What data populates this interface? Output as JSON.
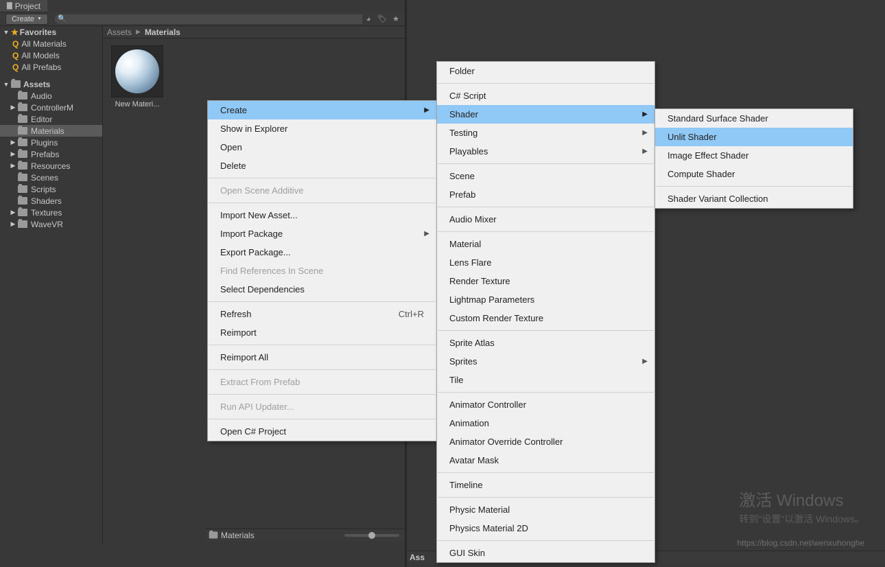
{
  "tab": {
    "title": "Project"
  },
  "toolbar": {
    "create": "Create",
    "search_placeholder": ""
  },
  "sidebar": {
    "favorites": {
      "label": "Favorites",
      "items": [
        "All Materials",
        "All Models",
        "All Prefabs"
      ]
    },
    "assets": {
      "label": "Assets",
      "items": [
        {
          "name": "Audio",
          "expand": false
        },
        {
          "name": "ControllerM",
          "expand": true
        },
        {
          "name": "Editor",
          "expand": false
        },
        {
          "name": "Materials",
          "expand": false,
          "selected": true
        },
        {
          "name": "Plugins",
          "expand": true
        },
        {
          "name": "Prefabs",
          "expand": true
        },
        {
          "name": "Resources",
          "expand": true
        },
        {
          "name": "Scenes",
          "expand": false
        },
        {
          "name": "Scripts",
          "expand": false
        },
        {
          "name": "Shaders",
          "expand": false
        },
        {
          "name": "Textures",
          "expand": true
        },
        {
          "name": "WaveVR",
          "expand": true
        }
      ]
    }
  },
  "breadcrumb": {
    "root": "Assets",
    "current": "Materials"
  },
  "assets": [
    {
      "name": "New Materi..."
    }
  ],
  "bottom": {
    "left_label": "Materials",
    "right_label": "Ass"
  },
  "menu1": [
    {
      "label": "Create",
      "type": "item",
      "selected": true,
      "arrow": true
    },
    {
      "label": "Show in Explorer",
      "type": "item"
    },
    {
      "label": "Open",
      "type": "item"
    },
    {
      "label": "Delete",
      "type": "item"
    },
    {
      "type": "sep"
    },
    {
      "label": "Open Scene Additive",
      "type": "item",
      "disabled": true
    },
    {
      "type": "sep"
    },
    {
      "label": "Import New Asset...",
      "type": "item"
    },
    {
      "label": "Import Package",
      "type": "item",
      "arrow": true
    },
    {
      "label": "Export Package...",
      "type": "item"
    },
    {
      "label": "Find References In Scene",
      "type": "item",
      "disabled": true
    },
    {
      "label": "Select Dependencies",
      "type": "item"
    },
    {
      "type": "sep"
    },
    {
      "label": "Refresh",
      "type": "item",
      "shortcut": "Ctrl+R"
    },
    {
      "label": "Reimport",
      "type": "item"
    },
    {
      "type": "sep"
    },
    {
      "label": "Reimport All",
      "type": "item"
    },
    {
      "type": "sep"
    },
    {
      "label": "Extract From Prefab",
      "type": "item",
      "disabled": true
    },
    {
      "type": "sep"
    },
    {
      "label": "Run API Updater...",
      "type": "item",
      "disabled": true
    },
    {
      "type": "sep"
    },
    {
      "label": "Open C# Project",
      "type": "item"
    }
  ],
  "menu2": [
    {
      "label": "Folder",
      "type": "item"
    },
    {
      "type": "sep"
    },
    {
      "label": "C# Script",
      "type": "item"
    },
    {
      "label": "Shader",
      "type": "item",
      "selected": true,
      "arrow": true
    },
    {
      "label": "Testing",
      "type": "item",
      "arrow": true
    },
    {
      "label": "Playables",
      "type": "item",
      "arrow": true
    },
    {
      "type": "sep"
    },
    {
      "label": "Scene",
      "type": "item"
    },
    {
      "label": "Prefab",
      "type": "item"
    },
    {
      "type": "sep"
    },
    {
      "label": "Audio Mixer",
      "type": "item"
    },
    {
      "type": "sep"
    },
    {
      "label": "Material",
      "type": "item"
    },
    {
      "label": "Lens Flare",
      "type": "item"
    },
    {
      "label": "Render Texture",
      "type": "item"
    },
    {
      "label": "Lightmap Parameters",
      "type": "item"
    },
    {
      "label": "Custom Render Texture",
      "type": "item"
    },
    {
      "type": "sep"
    },
    {
      "label": "Sprite Atlas",
      "type": "item"
    },
    {
      "label": "Sprites",
      "type": "item",
      "arrow": true
    },
    {
      "label": "Tile",
      "type": "item"
    },
    {
      "type": "sep"
    },
    {
      "label": "Animator Controller",
      "type": "item"
    },
    {
      "label": "Animation",
      "type": "item"
    },
    {
      "label": "Animator Override Controller",
      "type": "item"
    },
    {
      "label": "Avatar Mask",
      "type": "item"
    },
    {
      "type": "sep"
    },
    {
      "label": "Timeline",
      "type": "item"
    },
    {
      "type": "sep"
    },
    {
      "label": "Physic Material",
      "type": "item"
    },
    {
      "label": "Physics Material 2D",
      "type": "item"
    },
    {
      "type": "sep"
    },
    {
      "label": "GUI Skin",
      "type": "item"
    }
  ],
  "menu3": [
    {
      "label": "Standard Surface Shader",
      "type": "item"
    },
    {
      "label": "Unlit Shader",
      "type": "item",
      "hover": true
    },
    {
      "label": "Image Effect Shader",
      "type": "item"
    },
    {
      "label": "Compute Shader",
      "type": "item"
    },
    {
      "type": "sep"
    },
    {
      "label": "Shader Variant Collection",
      "type": "item"
    }
  ],
  "watermark": {
    "l1": "激活 Windows",
    "l2": "转到\"设置\"以激活 Windows。",
    "l3": "https://blog.csdn.net/wenxuhonghe"
  }
}
